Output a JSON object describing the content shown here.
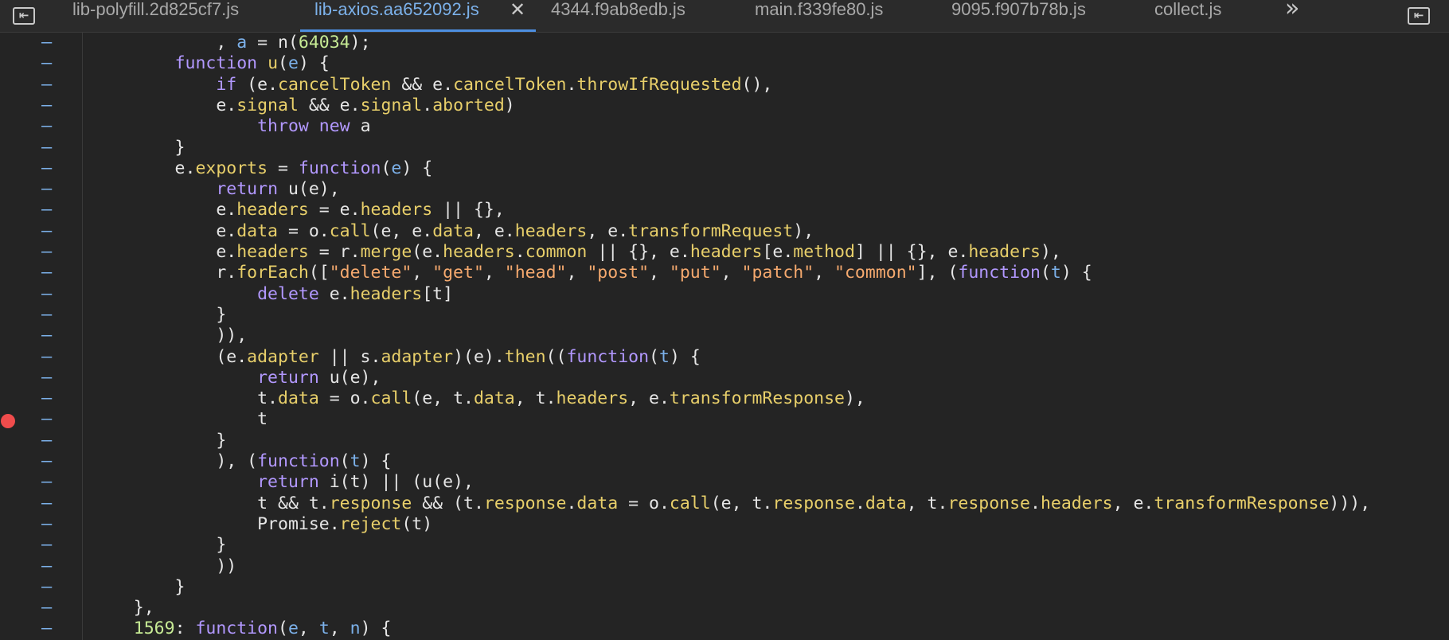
{
  "tabs": [
    {
      "label": "lib-polyfill.2d825cf7.js",
      "active": false
    },
    {
      "label": "lib-axios.aa652092.js",
      "active": true
    },
    {
      "label": "4344.f9ab8edb.js",
      "active": false
    },
    {
      "label": "main.f339fe80.js",
      "active": false
    },
    {
      "label": "9095.f907b78b.js",
      "active": false
    },
    {
      "label": "collect.js",
      "active": false
    }
  ],
  "icons": {
    "left_panel": "panel-toggle-left-icon",
    "right_panel": "panel-toggle-right-icon",
    "close_tab": "close-icon",
    "more_tabs": "chevron-double-right-icon"
  },
  "glyphs": {
    "left_panel": "⇤",
    "right_panel": "⇤",
    "close_tab": "✕",
    "more_tabs": "»"
  },
  "line_marker": "–",
  "breakpoint_line": 18,
  "colors": {
    "background": "#242424",
    "tabbar": "#2b2b2b",
    "active_tab_text": "#7cb1ea",
    "keyword": "#b298ff",
    "property": "#e8cf6a",
    "variable": "#7cb1ea",
    "string": "#f5a96e",
    "number": "#c7eb95",
    "breakpoint": "#f04c4c"
  },
  "code_lines": [
    [
      [
        "            , ",
        ""
      ],
      [
        "a",
        "vr"
      ],
      [
        " = n(",
        ""
      ],
      [
        "64034",
        "nm"
      ],
      [
        ");",
        ""
      ]
    ],
    [
      [
        "        ",
        ""
      ],
      [
        "function",
        "kw"
      ],
      [
        " ",
        ""
      ],
      [
        "u",
        "pr"
      ],
      [
        "(",
        ""
      ],
      [
        "e",
        "vr"
      ],
      [
        ") {",
        ""
      ]
    ],
    [
      [
        "            ",
        ""
      ],
      [
        "if",
        "kw"
      ],
      [
        " (e.",
        ""
      ],
      [
        "cancelToken",
        "pr"
      ],
      [
        " && e.",
        ""
      ],
      [
        "cancelToken",
        "pr"
      ],
      [
        ".",
        ""
      ],
      [
        "throwIfRequested",
        "pr"
      ],
      [
        "(),",
        ""
      ]
    ],
    [
      [
        "            e.",
        ""
      ],
      [
        "signal",
        "pr"
      ],
      [
        " && e.",
        ""
      ],
      [
        "signal",
        "pr"
      ],
      [
        ".",
        ""
      ],
      [
        "aborted",
        "pr"
      ],
      [
        ")",
        ""
      ]
    ],
    [
      [
        "                ",
        ""
      ],
      [
        "throw",
        "kw"
      ],
      [
        " ",
        ""
      ],
      [
        "new",
        "kw"
      ],
      [
        " a",
        ""
      ]
    ],
    [
      [
        "        }",
        ""
      ]
    ],
    [
      [
        "        e.",
        ""
      ],
      [
        "exports",
        "pr"
      ],
      [
        " = ",
        ""
      ],
      [
        "function",
        "kw"
      ],
      [
        "(",
        ""
      ],
      [
        "e",
        "vr"
      ],
      [
        ") {",
        ""
      ]
    ],
    [
      [
        "            ",
        ""
      ],
      [
        "return",
        "kw"
      ],
      [
        " u(e),",
        ""
      ]
    ],
    [
      [
        "            e.",
        ""
      ],
      [
        "headers",
        "pr"
      ],
      [
        " = e.",
        ""
      ],
      [
        "headers",
        "pr"
      ],
      [
        " || {},",
        ""
      ]
    ],
    [
      [
        "            e.",
        ""
      ],
      [
        "data",
        "pr"
      ],
      [
        " = o.",
        ""
      ],
      [
        "call",
        "pr"
      ],
      [
        "(e, e.",
        ""
      ],
      [
        "data",
        "pr"
      ],
      [
        ", e.",
        ""
      ],
      [
        "headers",
        "pr"
      ],
      [
        ", e.",
        ""
      ],
      [
        "transformRequest",
        "pr"
      ],
      [
        "),",
        ""
      ]
    ],
    [
      [
        "            e.",
        ""
      ],
      [
        "headers",
        "pr"
      ],
      [
        " = r.",
        ""
      ],
      [
        "merge",
        "pr"
      ],
      [
        "(e.",
        ""
      ],
      [
        "headers",
        "pr"
      ],
      [
        ".",
        ""
      ],
      [
        "common",
        "pr"
      ],
      [
        " || {}, e.",
        ""
      ],
      [
        "headers",
        "pr"
      ],
      [
        "[e.",
        ""
      ],
      [
        "method",
        "pr"
      ],
      [
        "] || {}, e.",
        ""
      ],
      [
        "headers",
        "pr"
      ],
      [
        "),",
        ""
      ]
    ],
    [
      [
        "            r.",
        ""
      ],
      [
        "forEach",
        "pr"
      ],
      [
        "([",
        ""
      ],
      [
        "\"delete\"",
        "st"
      ],
      [
        ", ",
        ""
      ],
      [
        "\"get\"",
        "st"
      ],
      [
        ", ",
        ""
      ],
      [
        "\"head\"",
        "st"
      ],
      [
        ", ",
        ""
      ],
      [
        "\"post\"",
        "st"
      ],
      [
        ", ",
        ""
      ],
      [
        "\"put\"",
        "st"
      ],
      [
        ", ",
        ""
      ],
      [
        "\"patch\"",
        "st"
      ],
      [
        ", ",
        ""
      ],
      [
        "\"common\"",
        "st"
      ],
      [
        "], (",
        ""
      ],
      [
        "function",
        "kw"
      ],
      [
        "(",
        ""
      ],
      [
        "t",
        "vr"
      ],
      [
        ") {",
        ""
      ]
    ],
    [
      [
        "                ",
        ""
      ],
      [
        "delete",
        "kw"
      ],
      [
        " e.",
        ""
      ],
      [
        "headers",
        "pr"
      ],
      [
        "[t]",
        ""
      ]
    ],
    [
      [
        "            }",
        ""
      ]
    ],
    [
      [
        "            )),",
        ""
      ]
    ],
    [
      [
        "            (e.",
        ""
      ],
      [
        "adapter",
        "pr"
      ],
      [
        " || s.",
        ""
      ],
      [
        "adapter",
        "pr"
      ],
      [
        ")(e).",
        ""
      ],
      [
        "then",
        "pr"
      ],
      [
        "((",
        ""
      ],
      [
        "function",
        "kw"
      ],
      [
        "(",
        ""
      ],
      [
        "t",
        "vr"
      ],
      [
        ") {",
        ""
      ]
    ],
    [
      [
        "                ",
        ""
      ],
      [
        "return",
        "kw"
      ],
      [
        " u(e),",
        ""
      ]
    ],
    [
      [
        "                t.",
        ""
      ],
      [
        "data",
        "pr"
      ],
      [
        " = o.",
        ""
      ],
      [
        "call",
        "pr"
      ],
      [
        "(e, t.",
        ""
      ],
      [
        "data",
        "pr"
      ],
      [
        ", t.",
        ""
      ],
      [
        "headers",
        "pr"
      ],
      [
        ", e.",
        ""
      ],
      [
        "transformResponse",
        "pr"
      ],
      [
        "),",
        ""
      ]
    ],
    [
      [
        "                t",
        ""
      ]
    ],
    [
      [
        "            }",
        ""
      ]
    ],
    [
      [
        "            ), (",
        ""
      ],
      [
        "function",
        "kw"
      ],
      [
        "(",
        ""
      ],
      [
        "t",
        "vr"
      ],
      [
        ") {",
        ""
      ]
    ],
    [
      [
        "                ",
        ""
      ],
      [
        "return",
        "kw"
      ],
      [
        " i(t) || (u(e),",
        ""
      ]
    ],
    [
      [
        "                t && t.",
        ""
      ],
      [
        "response",
        "pr"
      ],
      [
        " && (t.",
        ""
      ],
      [
        "response",
        "pr"
      ],
      [
        ".",
        ""
      ],
      [
        "data",
        "pr"
      ],
      [
        " = o.",
        ""
      ],
      [
        "call",
        "pr"
      ],
      [
        "(e, t.",
        ""
      ],
      [
        "response",
        "pr"
      ],
      [
        ".",
        ""
      ],
      [
        "data",
        "pr"
      ],
      [
        ", t.",
        ""
      ],
      [
        "response",
        "pr"
      ],
      [
        ".",
        ""
      ],
      [
        "headers",
        "pr"
      ],
      [
        ", e.",
        ""
      ],
      [
        "transformResponse",
        "pr"
      ],
      [
        "))),",
        ""
      ]
    ],
    [
      [
        "                Promise.",
        ""
      ],
      [
        "reject",
        "pr"
      ],
      [
        "(t)",
        ""
      ]
    ],
    [
      [
        "            }",
        ""
      ]
    ],
    [
      [
        "            ))",
        ""
      ]
    ],
    [
      [
        "        }",
        ""
      ]
    ],
    [
      [
        "    },",
        ""
      ]
    ],
    [
      [
        "    ",
        ""
      ],
      [
        "1569",
        "nm"
      ],
      [
        ": ",
        ""
      ],
      [
        "function",
        "kw"
      ],
      [
        "(",
        ""
      ],
      [
        "e",
        "vr"
      ],
      [
        ", ",
        ""
      ],
      [
        "t",
        "vr"
      ],
      [
        ", ",
        ""
      ],
      [
        "n",
        "vr"
      ],
      [
        ") {",
        ""
      ]
    ]
  ]
}
